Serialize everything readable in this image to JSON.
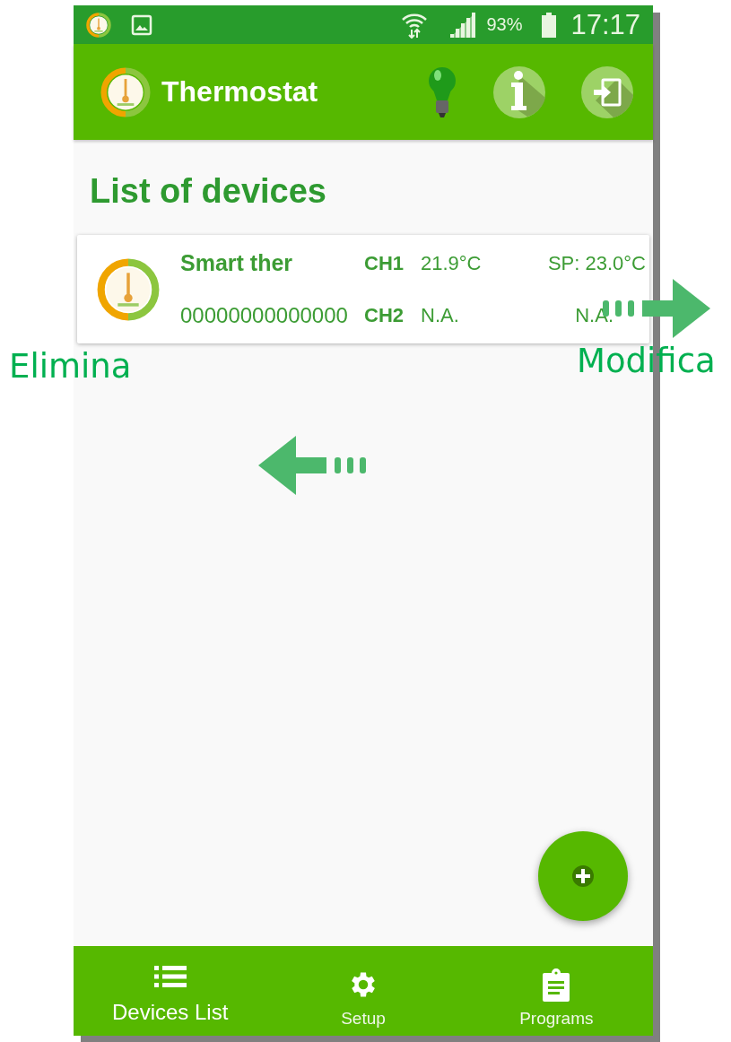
{
  "status_bar": {
    "battery": "93%",
    "time": "17:17"
  },
  "app_bar": {
    "title": "Thermostat"
  },
  "heading": "List of devices",
  "devices": [
    {
      "name": "Smart ther",
      "serial": "00000000000000",
      "channels": [
        {
          "label": "CH1",
          "temperature": "21.9°C",
          "setpoint": "SP: 23.0°C"
        },
        {
          "label": "CH2",
          "temperature": "N.A.",
          "setpoint": "N.A."
        }
      ]
    }
  ],
  "bottom_nav": [
    {
      "label": "Devices List",
      "selected": true
    },
    {
      "label": "Setup",
      "selected": false
    },
    {
      "label": "Programs",
      "selected": false
    }
  ],
  "annotations": [
    {
      "label": "Elimina",
      "kind": "left"
    },
    {
      "label": "Modifica",
      "kind": "right"
    }
  ]
}
